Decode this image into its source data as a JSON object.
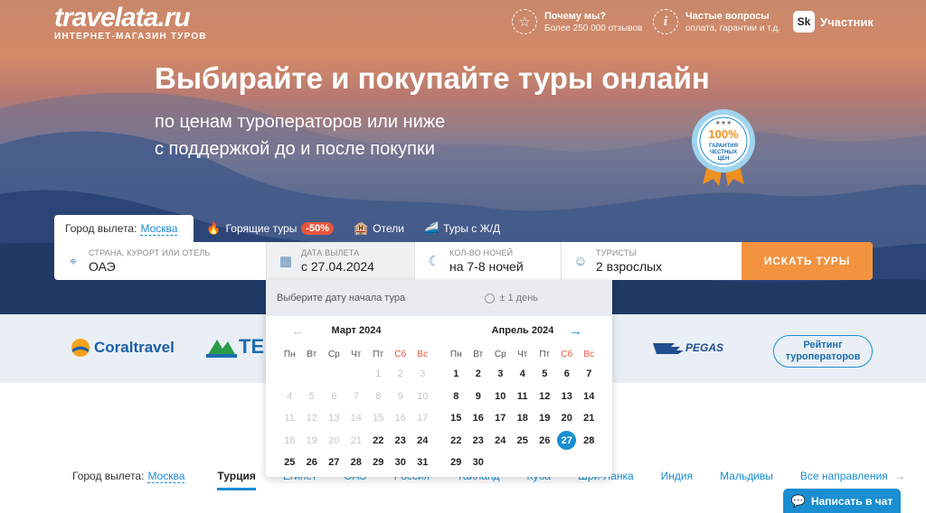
{
  "brand": {
    "logo": "travelata.ru",
    "tagline": "ИНТЕРНЕТ-МАГАЗИН ТУРОВ"
  },
  "header": {
    "why": {
      "title": "Почему мы?",
      "sub": "Более 250 000 отзывов"
    },
    "faq": {
      "title": "Частые вопросы",
      "sub": "оплата, гарантии и т.д."
    },
    "sk": {
      "icon": "Sk",
      "label": "Участник"
    }
  },
  "hero": {
    "title": "Выбирайте и покупайте туры онлайн",
    "line1": "по ценам туроператоров или ниже",
    "line2": "с поддержкой до и после покупки",
    "badge": {
      "big": "100%",
      "l1": "ГАРАНТИЯ",
      "l2": "ЧЕСТНЫХ",
      "l3": "ЦЕН"
    }
  },
  "tabs": {
    "city_label": "Город вылета:",
    "city": "Москва",
    "hot": "Горящие туры",
    "hot_badge": "-50%",
    "hotels": "Отели",
    "rail": "Туры с Ж/Д"
  },
  "search": {
    "dest_label": "СТРАНА, КУРОРТ ИЛИ ОТЕЛЬ",
    "dest_value": "ОАЭ",
    "date_label": "ДАТА ВЫЛЕТА",
    "date_value": "с 27.04.2024",
    "nights_label": "КОЛ-ВО НОЧЕЙ",
    "nights_value": "на 7-8 ночей",
    "tourists_label": "ТУРИСТЫ",
    "tourists_value": "2 взрослых",
    "button": "ИСКАТЬ ТУРЫ"
  },
  "calendar": {
    "prompt": "Выберите дату начала тура",
    "flex": "± 1 день",
    "weekdays": [
      "Пн",
      "Вт",
      "Ср",
      "Чт",
      "Пт",
      "Сб",
      "Вс"
    ],
    "months": [
      {
        "name": "Март 2024",
        "offset": 4,
        "days": 31,
        "enabled_from": 22,
        "selected": null
      },
      {
        "name": "Апрель 2024",
        "offset": 0,
        "days": 30,
        "enabled_from": 1,
        "selected": 27
      }
    ]
  },
  "operators": {
    "coral": "Coraltravel",
    "tez": "TE",
    "pegas": "PEGAS",
    "rating_l1": "Рейтинг",
    "rating_l2": "туроператоров"
  },
  "destinations": {
    "city_label": "Город вылета:",
    "city": "Москва",
    "items": [
      "Турция",
      "Египет",
      "ОАЭ",
      "Россия",
      "Таиланд",
      "Куба",
      "Шри-Ланка",
      "Индия",
      "Мальдивы"
    ],
    "all": "Все направления"
  },
  "chat": {
    "label": "Написать в чат"
  }
}
